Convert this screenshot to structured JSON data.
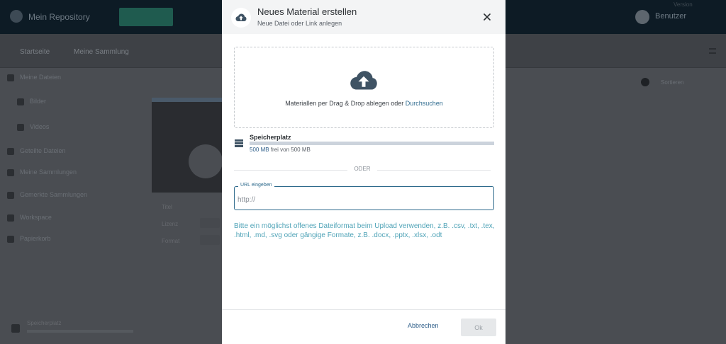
{
  "background": {
    "repo_selector": "Mein Repository",
    "user_name": "Benutzer",
    "top_right_small": "Version",
    "breadcrumb_root": "Startseite",
    "breadcrumb_path": "Meine Sammlung",
    "sidebar": [
      {
        "label": "Meine Dateien",
        "indent": false
      },
      {
        "label": "Bilder",
        "indent": true
      },
      {
        "label": "Videos",
        "indent": true
      },
      {
        "label": "Geteilte Dateien",
        "indent": false
      },
      {
        "label": "Meine Sammlungen",
        "indent": false
      },
      {
        "label": "Gemerkte Sammlungen",
        "indent": false
      },
      {
        "label": "Workspace",
        "indent": false
      },
      {
        "label": "Papierkorb",
        "indent": false
      }
    ],
    "card_title": "Titel",
    "card_meta": [
      "Lizenz",
      "Format"
    ],
    "right_tools_label": "Sortieren",
    "storage_label": "Speicherplatz"
  },
  "modal": {
    "title": "Neues Material erstellen",
    "subtitle": "Neue Datei oder Link anlegen",
    "close_icon": "close-icon",
    "header_icon": "cloud-upload-icon",
    "dropzone": {
      "text_before": "Materiallen per Drag & Drop ablegen oder ",
      "link": "Durchsuchen",
      "icon": "cloud-upload-icon"
    },
    "storage": {
      "icon": "storage-list-icon",
      "label": "Speicherplatz",
      "free": "500 MB",
      "of_text": "frei von 500 MB",
      "used_fraction": 0
    },
    "divider_text": "ODER",
    "url": {
      "legend": "URL eingeben",
      "placeholder": "http://",
      "value": ""
    },
    "hint": "Bitte ein möglichst offenes Dateiformat beim Upload verwenden, z.B. .csv, .txt, .tex, .html, .md, .svg oder gängige Formate, z.B. .docx, .pptx, .xlsx, .odt",
    "buttons": {
      "cancel": "Abbrechen",
      "ok": "Ok"
    }
  },
  "colors": {
    "accent": "#2f5f8a",
    "hint": "#4fa3b7",
    "topbar": "#0d1b25"
  }
}
